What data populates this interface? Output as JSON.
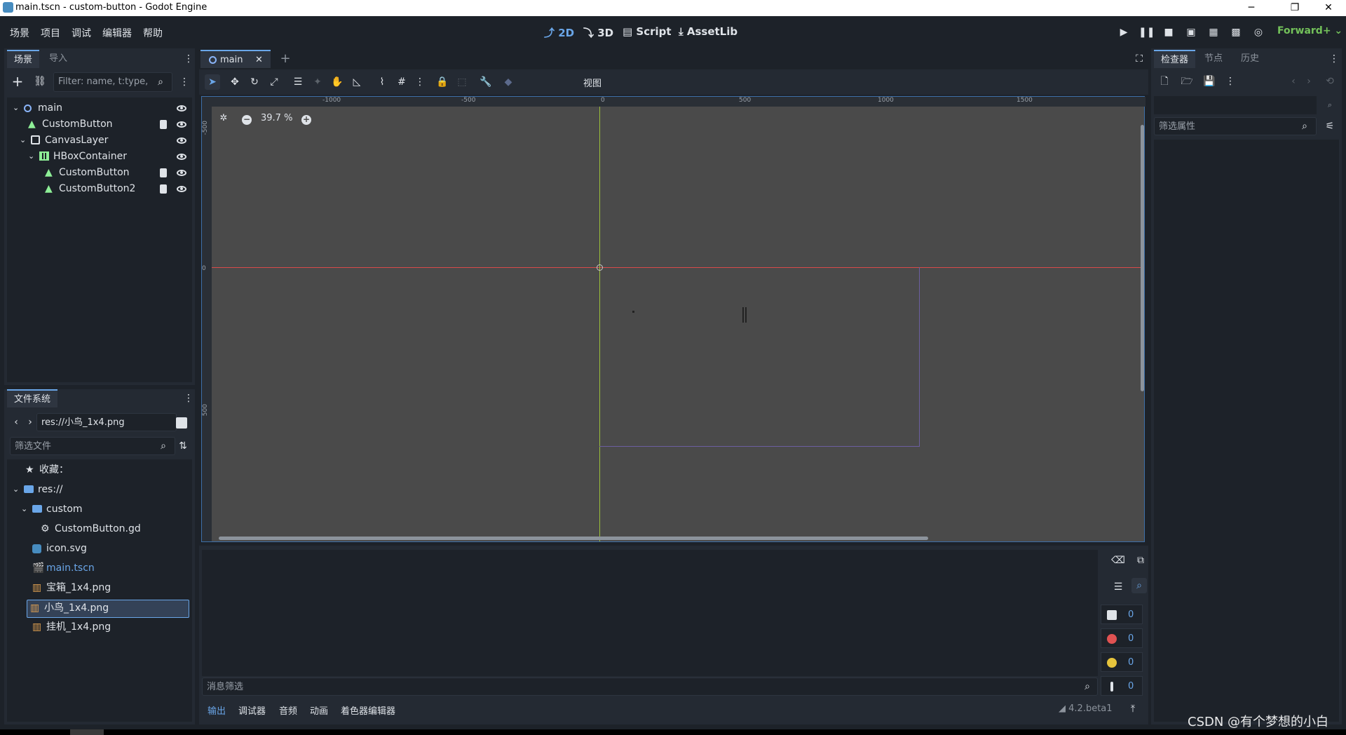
{
  "window": {
    "title": "main.tscn - custom-button - Godot Engine"
  },
  "menu": [
    "场景",
    "项目",
    "调试",
    "编辑器",
    "帮助"
  ],
  "modes": [
    {
      "label": "2D",
      "active": true
    },
    {
      "label": "3D",
      "active": false
    },
    {
      "label": "Script",
      "active": false
    },
    {
      "label": "AssetLib",
      "active": false
    }
  ],
  "renderer": "Forward+",
  "scene_dock": {
    "tabs": [
      "场景",
      "导入"
    ],
    "filter_placeholder": "Filter: name, t:type,",
    "nodes": [
      {
        "label": "main",
        "icon": "node2d-icon",
        "depth": 0
      },
      {
        "label": "CustomButton",
        "icon": "custom-button-icon",
        "depth": 1
      },
      {
        "label": "CanvasLayer",
        "icon": "canvaslayer-icon",
        "depth": 1
      },
      {
        "label": "HBoxContainer",
        "icon": "hbox-icon",
        "depth": 2
      },
      {
        "label": "CustomButton",
        "icon": "custom-button-icon",
        "depth": 3
      },
      {
        "label": "CustomButton2",
        "icon": "custom-button-icon",
        "depth": 3
      }
    ]
  },
  "filesystem": {
    "title": "文件系统",
    "path": "res://小鸟_1x4.png",
    "filter_placeholder": "筛选文件",
    "favorites": "收藏：",
    "root": "res://",
    "items": [
      {
        "label": "custom",
        "icon": "folder-icon",
        "depth": 1
      },
      {
        "label": "CustomButton.gd",
        "icon": "gear-icon",
        "depth": 2
      },
      {
        "label": "icon.svg",
        "icon": "svg-icon",
        "depth": 1
      },
      {
        "label": "main.tscn",
        "icon": "scene-icon",
        "depth": 1,
        "accent": true
      },
      {
        "label": "宝箱_1x4.png",
        "icon": "image-icon",
        "depth": 1
      },
      {
        "label": "小鸟_1x4.png",
        "icon": "image-icon",
        "depth": 1,
        "selected": true
      },
      {
        "label": "挂机_1x4.png",
        "icon": "image-icon",
        "depth": 1
      }
    ]
  },
  "editor": {
    "tab": "main",
    "view_menu": "视图",
    "zoom": "39.7 %",
    "ruler_h": [
      "-1000",
      "-500",
      "0",
      "500",
      "1000",
      "1500"
    ],
    "ruler_v": [
      "-500",
      "0",
      "500"
    ]
  },
  "inspector": {
    "tabs": [
      "检查器",
      "节点",
      "历史"
    ],
    "filter_placeholder": "筛选属性"
  },
  "output": {
    "filter_placeholder": "消息筛选",
    "counts": [
      "0",
      "0",
      "0",
      "0"
    ],
    "tabs": [
      "输出",
      "调试器",
      "音频",
      "动画",
      "着色器编辑器"
    ],
    "version": "4.2.beta1"
  },
  "watermark": "CSDN @有个梦想的小白",
  "colors": {
    "accent": "#6aa6e8",
    "node_green": "#8eef97",
    "x_axis": "#d94a4a",
    "y_axis": "#9cbf3a",
    "renderer": "#73c15a"
  }
}
